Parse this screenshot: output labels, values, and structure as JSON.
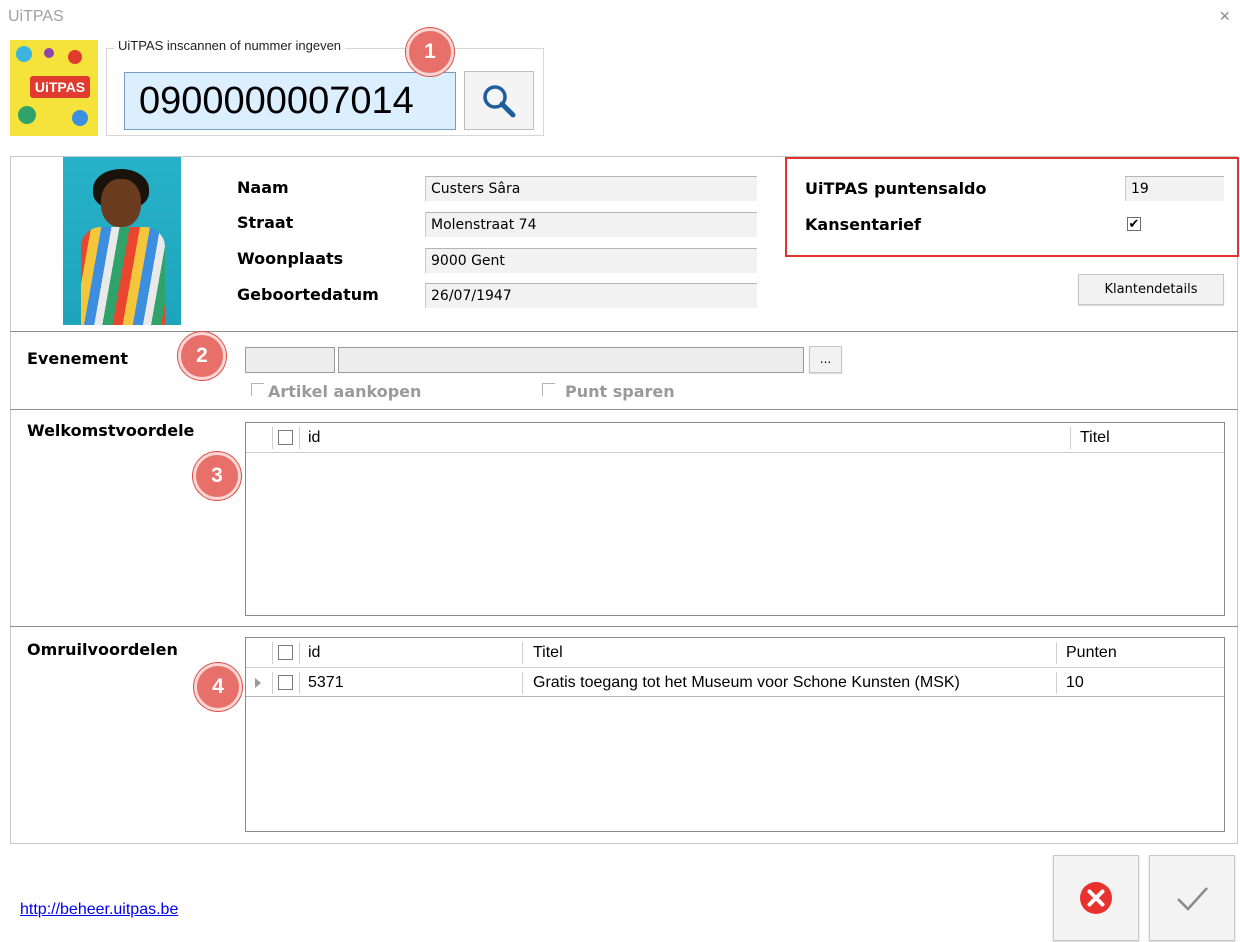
{
  "window": {
    "title": "UiTPAS",
    "close_glyph": "×"
  },
  "scan": {
    "legend": "UiTPAS inscannen of nummer ingeven",
    "number": "0900000007014",
    "search_icon": "search-icon"
  },
  "logo": {
    "text": "UiTPAS"
  },
  "badges": [
    "1",
    "2",
    "3",
    "4"
  ],
  "customer": {
    "labels": {
      "name": "Naam",
      "street": "Straat",
      "city": "Woonplaats",
      "birthdate": "Geboortedatum"
    },
    "values": {
      "name": "Custers Sâra",
      "street": "Molenstraat 74",
      "city": "9000 Gent",
      "birthdate": "26/07/1947"
    }
  },
  "points": {
    "balance_label": "UiTPAS puntensaldo",
    "balance_value": "19",
    "kansentarief_label": "Kansentarief",
    "kansentarief_checked": true,
    "check_glyph": "✔",
    "details_button": "Klantendetails"
  },
  "event": {
    "label": "Evenement",
    "browse_button": "...",
    "buy_article_label": "Artikel aankopen",
    "save_point_label": "Punt sparen"
  },
  "welcome": {
    "label": "Welkomstvoordele",
    "columns": [
      "id",
      "Titel"
    ],
    "rows": []
  },
  "exchange": {
    "label": "Omruilvoordelen",
    "columns": [
      "id",
      "Titel",
      "Punten"
    ],
    "rows": [
      {
        "id": "5371",
        "title": "Gratis toegang tot het Museum voor Schone Kunsten (MSK)",
        "points": "10"
      }
    ]
  },
  "footer": {
    "link": "http://beheer.uitpas.be",
    "cancel_icon": "cancel-icon",
    "confirm_icon": "checkmark-icon"
  },
  "colors": {
    "accent_red": "#e0332e",
    "badge": "#e8706a",
    "input_bg": "#dcefff",
    "link": "#0000ee"
  }
}
